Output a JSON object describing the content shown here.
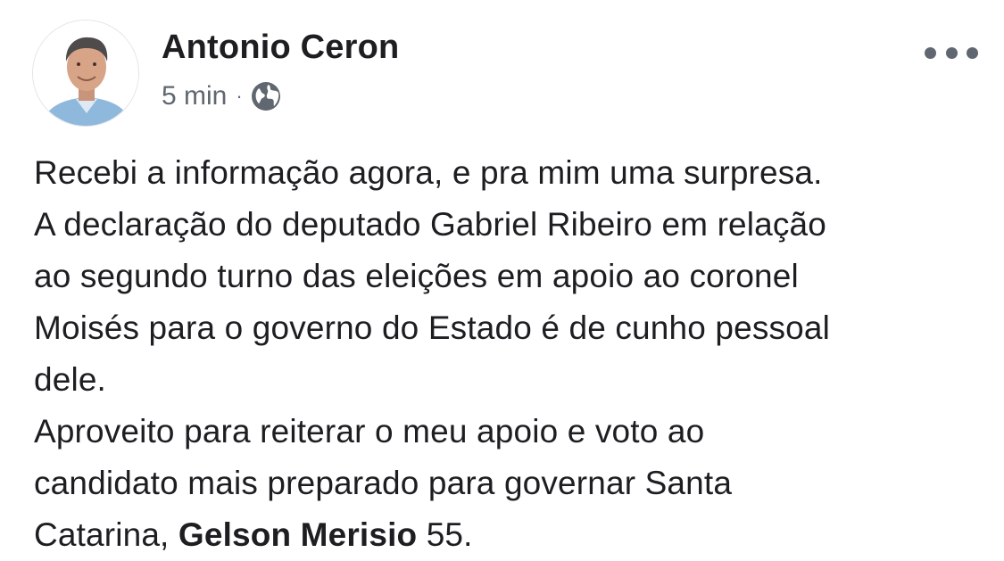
{
  "post": {
    "author": "Antonio Ceron",
    "time": "5 min",
    "separator": "·",
    "privacy_icon": "globe-icon",
    "more_icon": "more-options-icon",
    "lines": [
      "Recebi a informação agora, e pra mim uma surpresa.",
      "A declaração do deputado Gabriel Ribeiro em relação",
      "ao segundo turno das eleições em apoio ao coronel",
      "Moisés para o governo do Estado é de cunho pessoal",
      "dele.",
      "Aproveito para reiterar o meu apoio e voto ao",
      "candidato mais preparado para governar Santa"
    ],
    "last_line": {
      "prefix": "Catarina, ",
      "bold": "Gelson Merisio",
      "suffix": " 55."
    }
  },
  "colors": {
    "text": "#1c1e21",
    "meta": "#606770",
    "background": "#ffffff"
  }
}
